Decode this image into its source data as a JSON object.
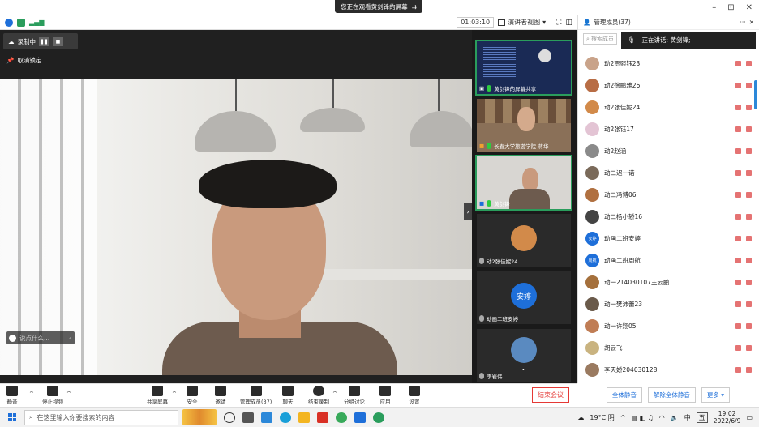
{
  "share_banner": "您正在观看黄剑锋的屏幕",
  "window_controls": {
    "minimize": "–",
    "restore": "⊡",
    "close": "✕"
  },
  "topbar": {
    "timer": "01:03:10",
    "view_mode": "演讲者视图"
  },
  "recording": {
    "label": "录制中"
  },
  "unlock_label": "取消锁定",
  "say_something": "说点什么...",
  "thumbnails": [
    {
      "label": "黄剑锋的屏幕共享"
    },
    {
      "label": "长春大学旅游学院-蒋华"
    },
    {
      "label": "黄剑锋"
    },
    {
      "label": "动2张佳妮24"
    },
    {
      "label": "动画二班安婷",
      "avatar_text": "安婷"
    },
    {
      "label": "李岩伟"
    }
  ],
  "panel": {
    "title": "管理成员(37)",
    "more": "···",
    "search_placeholder": "搜索成员",
    "speaking": "正在讲话: 黄剑锋;",
    "members": [
      {
        "name": "动2贾熙钰23",
        "color": "#c9a38a"
      },
      {
        "name": "动2徐鹏雅26",
        "color": "#b86d45"
      },
      {
        "name": "动2张佳妮24",
        "color": "#d28a4a"
      },
      {
        "name": "动2张钰17",
        "color": "#e3c4d4"
      },
      {
        "name": "动2赵涵",
        "color": "#8a8a8a"
      },
      {
        "name": "动二迟一诺",
        "color": "#7a6a5a"
      },
      {
        "name": "动二冯博06",
        "color": "#b07040"
      },
      {
        "name": "动二杨小轿16",
        "color": "#444"
      },
      {
        "name": "动画二班安婷",
        "color": "#1e6fd9",
        "avatar_text": "安婷"
      },
      {
        "name": "动画二班周航",
        "color": "#1e6fd9",
        "avatar_text": "周航"
      },
      {
        "name": "动一214030107王云鹏",
        "color": "#a5703c"
      },
      {
        "name": "动一樊沛蕾23",
        "color": "#6a5a4a"
      },
      {
        "name": "动一许翔05",
        "color": "#c07d55"
      },
      {
        "name": "胡云飞",
        "color": "#c9b380"
      },
      {
        "name": "李天娇204030128",
        "color": "#9a7a60"
      }
    ]
  },
  "toolbar": {
    "mute": "静音",
    "stop_video": "停止视频",
    "share_screen": "共享屏幕",
    "security": "安全",
    "invite": "邀请",
    "manage_members": "管理成员(37)",
    "chat": "聊天",
    "end_recording": "结束录制",
    "breakout": "分组讨论",
    "apps": "应用",
    "settings": "设置",
    "end_meeting": "结束会议"
  },
  "panel_actions": {
    "mute_all": "全体静音",
    "unmute_all": "解除全体静音",
    "more": "更多"
  },
  "taskbar": {
    "search_placeholder": "在这里输入你要搜索的内容",
    "weather": "19°C 阴",
    "ime": "中",
    "ime2": "五",
    "time": "19:02",
    "date": "2022/6/9"
  }
}
